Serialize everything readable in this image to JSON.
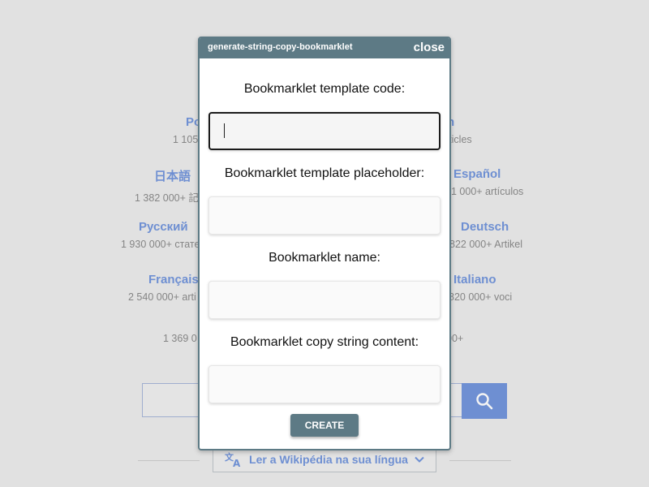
{
  "background": {
    "languages": [
      {
        "name": "Po",
        "count": "1 105"
      },
      {
        "name": "n",
        "count": "rticles"
      },
      {
        "name": "日本語",
        "count": "1 382 000+ 記"
      },
      {
        "name": "Español",
        "count": "1 000+ artículos"
      },
      {
        "name": "Русский",
        "count": "1 930 000+ стате"
      },
      {
        "name": "Deutsch",
        "count": "822 000+ Artikel"
      },
      {
        "name": "Français",
        "count": "2 540 000+ arti"
      },
      {
        "name": "Italiano",
        "count": "820 000+ voci"
      },
      {
        "name": "",
        "count": "1 369 0"
      },
      {
        "name": "",
        "count": "00+"
      }
    ],
    "language_button_label": "Ler a Wikipédia na sua língua"
  },
  "modal": {
    "title": "generate-string-copy-bookmarklet",
    "close_label": "close",
    "fields": [
      {
        "label": "Bookmarklet template code:",
        "value": "",
        "placeholder": ""
      },
      {
        "label": "Bookmarklet template placeholder:",
        "value": "",
        "placeholder": ""
      },
      {
        "label": "Bookmarklet name:",
        "value": "",
        "placeholder": ""
      },
      {
        "label": "Bookmarklet copy string content:",
        "value": "",
        "placeholder": ""
      }
    ],
    "create_label": "CREATE"
  },
  "colors": {
    "modal_header": "#5d7a85",
    "link_blue": "#3366cc",
    "search_button": "#3366cc"
  }
}
